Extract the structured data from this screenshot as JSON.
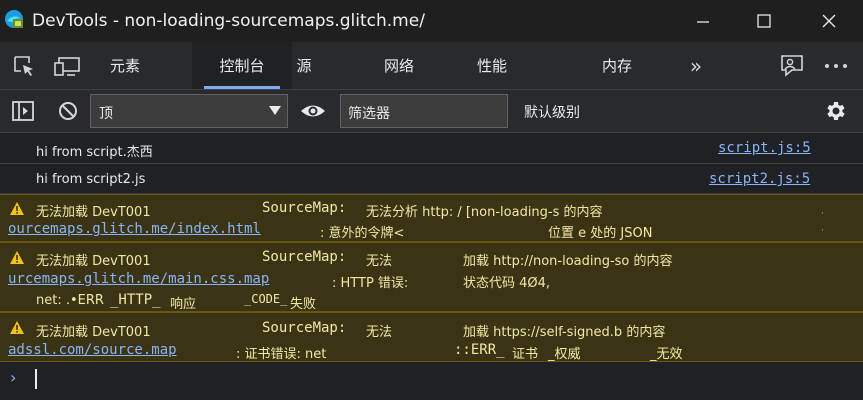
{
  "window": {
    "title": "DevTools - non-loading-sourcemaps.glitch.me/"
  },
  "tabs": [
    {
      "label": "元素"
    },
    {
      "label": "控制台"
    },
    {
      "label": "源"
    },
    {
      "label": "网络"
    },
    {
      "label": "性能"
    },
    {
      "label": "内存"
    }
  ],
  "toolbar": {
    "context": "顶",
    "filter_placeholder": "筛选器",
    "levels": "默认级别"
  },
  "messages": [
    {
      "text": "hi from script.杰西",
      "source": "script.js:5"
    },
    {
      "text": "hi from script2.js",
      "source": "script2.js:5"
    }
  ],
  "warnings": [
    {
      "line1": {
        "a": "无法加载 DevT001",
        "b": "SourceMap:",
        "c": "无法分析 http: / [non-loading-s 的内容"
      },
      "line2": {
        "link": "ourcemaps.glitch.me/index.html",
        "d": ": 意外的令牌<",
        "e": "位置 e 处的 JSON"
      }
    },
    {
      "line1": {
        "a": "无法加载 DevT001",
        "b": "SourceMap:",
        "c": "无法",
        "d": "加载 http://non-loading-so 的内容"
      },
      "line2": {
        "link": "urcemaps.glitch.me/main.css.map",
        "d": ": HTTP 错误:",
        "e": "状态代码 4Ø4,"
      },
      "line3": {
        "a": "net: .•ERR",
        "b": "_HTTP_",
        "c": "响应",
        "d": "_CODE_",
        "e": "失败"
      }
    },
    {
      "line1": {
        "a": "无法加载 DevT001",
        "b": "SourceMap:",
        "c": "无法",
        "d": "加载 https://self-signed.b 的内容"
      },
      "line2": {
        "link": "adssl.com/source.map",
        "d": ": 证书错误: net",
        "e": "::ERR_",
        "f": "证书",
        "g": "_权威",
        "h": "_无效"
      }
    }
  ],
  "colors": {
    "warning_bg": "#3a3414",
    "link": "#8ab4f8",
    "accent": "#7cacf8"
  }
}
